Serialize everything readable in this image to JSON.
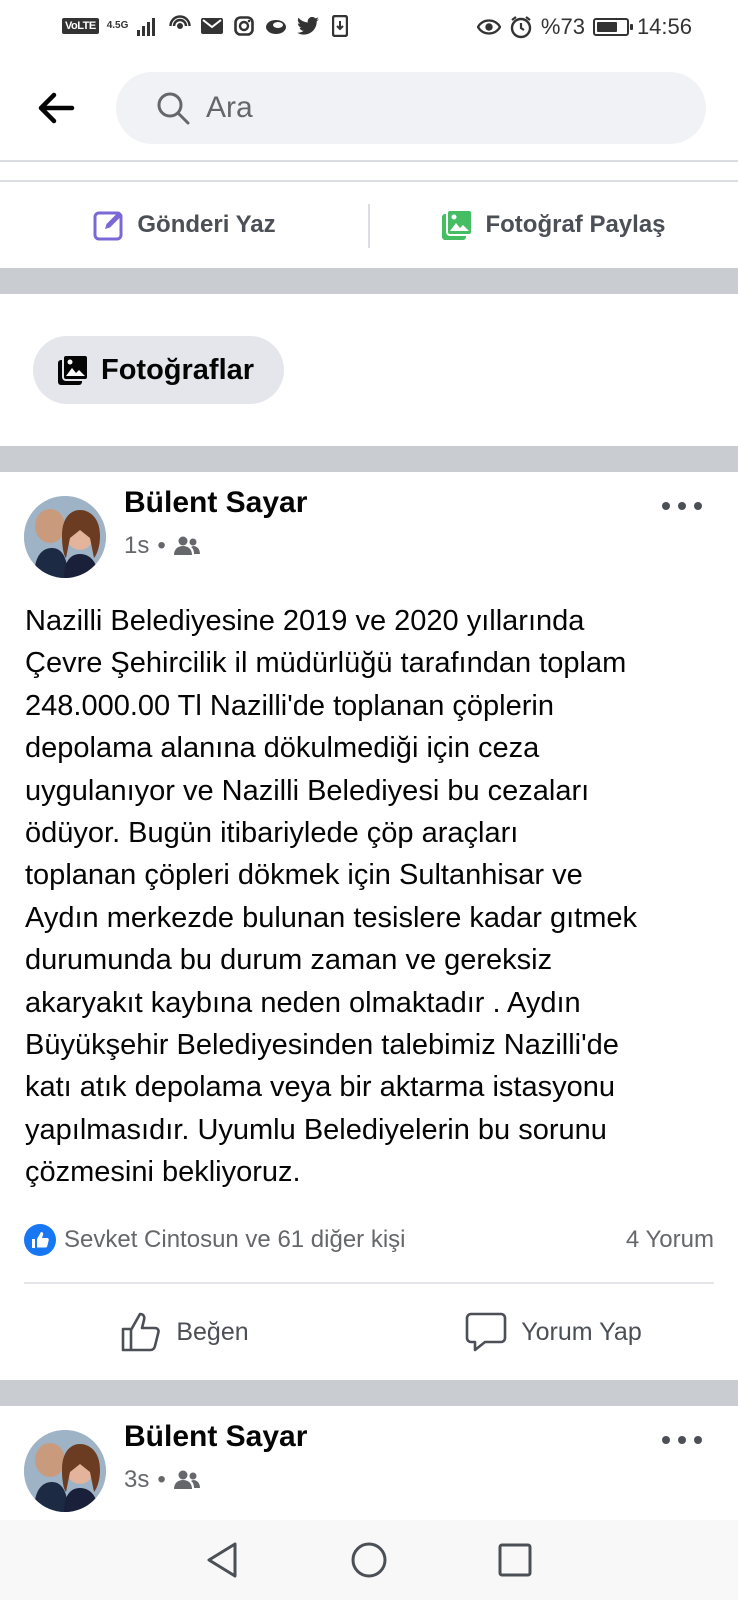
{
  "status_bar": {
    "volte": "VoLTE",
    "network": "4.5G",
    "battery_percent": "%73",
    "time": "14:56",
    "battery_level": 0.73
  },
  "header": {
    "search_placeholder": "Ara"
  },
  "composer": {
    "write_post": "Gönderi Yaz",
    "share_photo": "Fotoğraf Paylaş"
  },
  "photos_chip": {
    "label": "Fotoğraflar"
  },
  "posts": [
    {
      "author": "Bülent Sayar",
      "time": "1s",
      "audience_icon": "friends-icon",
      "text": "Nazilli Belediyesine 2019 ve 2020 yıllarında\nÇevre Şehircilik il müdürlüğü tarafından toplam\n248.000.00 Tl Nazilli'de toplanan  çöplerin\ndepolama alanına dökulmediği için ceza\nuygulanıyor ve Nazilli Belediyesi bu cezaları\nödüyor. Bugün itibariylede çöp araçları\ntoplanan çöpleri dökmek için Sultanhisar ve\nAydın merkezde bulunan tesislere kadar gıtmek\ndurumunda bu durum zaman ve gereksiz\nakaryakıt kaybına neden olmaktadır . Aydın\nBüyükşehir Belediyesinden talebimiz Nazilli'de\nkatı atık depolama veya  bir aktarma istasyonu\nyapılmasıdır. Uyumlu Belediyelerin bu sorunu\nçözmesini  bekliyoruz.",
      "reactions": "Sevket Cintosun ve 61 diğer kişi",
      "comments": "4 Yorum",
      "like_label": "Beğen",
      "comment_label": "Yorum Yap"
    },
    {
      "author": "Bülent Sayar",
      "time": "3s",
      "audience_icon": "friends-icon"
    }
  ],
  "colors": {
    "accent": "#1877f2",
    "compose_icon": "#7b68d6",
    "photo_icon": "#45bd62",
    "separator": "#c9ccd1"
  }
}
